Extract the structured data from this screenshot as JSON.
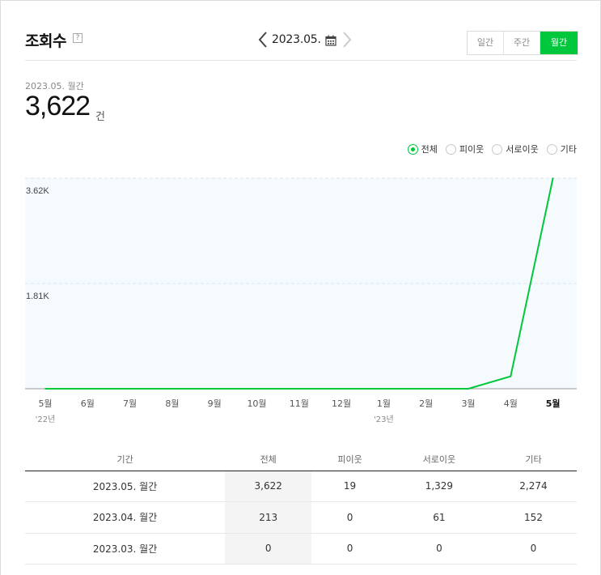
{
  "header": {
    "title": "조회수",
    "help": "?",
    "date": "2023.05.",
    "tabs": [
      {
        "label": "일간",
        "active": false
      },
      {
        "label": "주간",
        "active": false
      },
      {
        "label": "월간",
        "active": true
      }
    ]
  },
  "summary": {
    "period": "2023.05. 월간",
    "value": "3,622",
    "unit": "건"
  },
  "filters": [
    {
      "label": "전체",
      "selected": true
    },
    {
      "label": "피이웃",
      "selected": false
    },
    {
      "label": "서로이웃",
      "selected": false
    },
    {
      "label": "기타",
      "selected": false
    }
  ],
  "colors": {
    "accent": "#00c73c",
    "chart_bg": "#f5fafe"
  },
  "chart_data": {
    "type": "line",
    "x": [
      "5월",
      "6월",
      "7월",
      "8월",
      "9월",
      "10월",
      "11월",
      "12월",
      "1월",
      "2월",
      "3월",
      "4월",
      "5월"
    ],
    "year_labels": [
      {
        "index": 0,
        "text": "'22년"
      },
      {
        "index": 8,
        "text": "'23년"
      }
    ],
    "y_ticks": [
      {
        "value": 3622,
        "label": "3.62K"
      },
      {
        "value": 1811,
        "label": "1.81K"
      }
    ],
    "ylim": [
      0,
      3622
    ],
    "series": [
      {
        "values": [
          0,
          0,
          0,
          0,
          0,
          0,
          0,
          0,
          0,
          0,
          0,
          213,
          3622
        ]
      }
    ],
    "highlight_index": 12,
    "grid": true
  },
  "table": {
    "headers": [
      "기간",
      "전체",
      "피이웃",
      "서로이웃",
      "기타"
    ],
    "rows": [
      [
        "2023.05. 월간",
        "3,622",
        "19",
        "1,329",
        "2,274"
      ],
      [
        "2023.04. 월간",
        "213",
        "0",
        "61",
        "152"
      ],
      [
        "2023.03. 월간",
        "0",
        "0",
        "0",
        "0"
      ]
    ]
  }
}
